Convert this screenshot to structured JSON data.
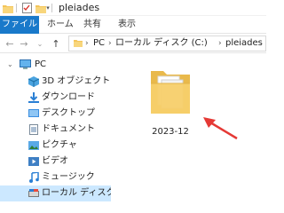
{
  "window": {
    "title": "pleiades"
  },
  "ribbon": {
    "tabs": [
      "ファイル",
      "ホーム",
      "共有",
      "表示"
    ]
  },
  "address": {
    "crumbs": [
      "PC",
      "ローカル ディスク (C:)",
      "pleiades"
    ]
  },
  "nav": {
    "items": [
      {
        "label": "PC",
        "icon": "pc-icon"
      },
      {
        "label": "3D オブジェクト",
        "icon": "3d-objects-icon"
      },
      {
        "label": "ダウンロード",
        "icon": "downloads-icon"
      },
      {
        "label": "デスクトップ",
        "icon": "desktop-icon"
      },
      {
        "label": "ドキュメント",
        "icon": "documents-icon"
      },
      {
        "label": "ピクチャ",
        "icon": "pictures-icon"
      },
      {
        "label": "ビデオ",
        "icon": "videos-icon"
      },
      {
        "label": "ミュージック",
        "icon": "music-icon"
      },
      {
        "label": "ローカル ディスク (C:)",
        "icon": "local-disk-icon",
        "selected": true
      }
    ]
  },
  "content": {
    "items": [
      {
        "name": "2023-12",
        "type": "folder"
      }
    ]
  },
  "colors": {
    "accent": "#1979ca",
    "selection": "#cce8ff",
    "folder": "#f6cf6a",
    "annotation_arrow": "#e53935"
  }
}
